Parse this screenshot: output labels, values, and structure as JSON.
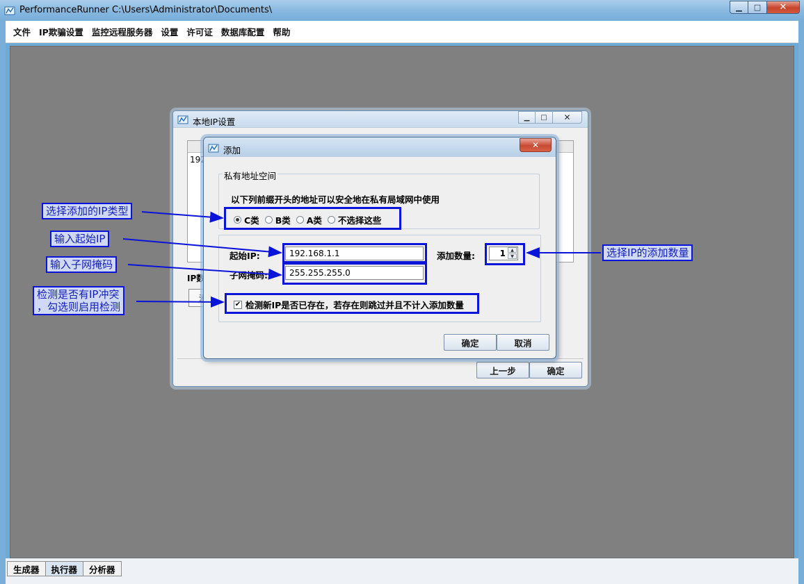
{
  "window": {
    "title": "PerformanceRunner  C:\\Users\\Administrator\\Documents\\",
    "controls": {
      "minimize": "▁",
      "maximize": "□",
      "close": "✕"
    }
  },
  "menu": {
    "items": [
      {
        "label": "文件"
      },
      {
        "label": "IP欺骗设置"
      },
      {
        "label": "监控远程服务器"
      },
      {
        "label": "设置"
      },
      {
        "label": "许可证"
      },
      {
        "label": "数据库配置"
      },
      {
        "label": "帮助"
      }
    ]
  },
  "bottom_tabs": [
    {
      "label": "生成器",
      "active": false
    },
    {
      "label": "执行器",
      "active": true
    },
    {
      "label": "分析器",
      "active": false
    }
  ],
  "dialog_local_ip": {
    "title": "本地IP设置",
    "table_first_row": "192",
    "ip_count_label": "IP数",
    "stub_button": "添",
    "prev_button": "上一步",
    "ok_button": "确定"
  },
  "dialog_add": {
    "title": "添加",
    "close": "✕",
    "group_title": "私有地址空间",
    "hint": "以下列前缀开头的地址可以安全地在私有局域网中使用",
    "radio_options": [
      {
        "label": "C类",
        "selected": true
      },
      {
        "label": "B类",
        "selected": false
      },
      {
        "label": "A类",
        "selected": false
      },
      {
        "label": "不选择这些",
        "selected": false
      }
    ],
    "start_ip_label": "起始IP:",
    "start_ip_value": "192.168.1.1",
    "subnet_label": "子网掩码:",
    "subnet_value": "255.255.255.0",
    "add_count_label": "添加数量:",
    "add_count_value": "1",
    "check_label": "检测新IP是否已存在，若存在则跳过并且不计入添加数量",
    "check_mark": "✔",
    "checked": true,
    "ok_button": "确定",
    "cancel_button": "取消"
  },
  "callouts": {
    "ip_type": "选择添加的IP类型",
    "start_ip": "输入起始IP",
    "subnet": "输入子网掩码",
    "conflict_line1": "检测是否有IP冲突",
    "conflict_line2": "，勾选则启用检测",
    "count": "选择IP的添加数量"
  },
  "colors": {
    "annotation_blue": "#0a14d8",
    "callout_fill": "#cfd8f5",
    "desktop_gray": "#808080"
  }
}
